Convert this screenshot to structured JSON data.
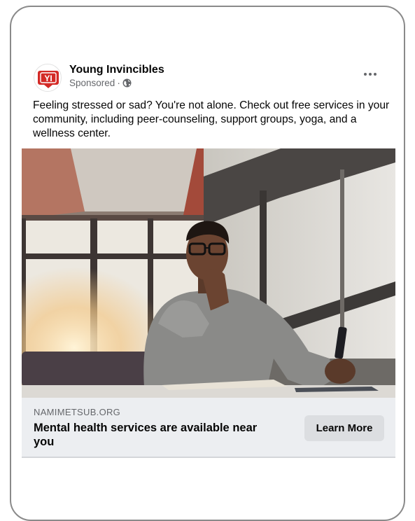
{
  "ad": {
    "page_name": "Young Invincibles",
    "sponsored_label": "Sponsored",
    "separator": "·",
    "logo_text": "YI",
    "body_text": "Feeling stressed or sad? You're not alone. Check out free services in your community, including peer-counseling, support groups, yoga, and a wellness center.",
    "image_description_icon": "photo-man-thinking",
    "link": {
      "domain": "NAMIMETSUB.ORG",
      "headline": "Mental health services are available near you",
      "cta_label": "Learn More"
    }
  },
  "icons": {
    "privacy": "globe-icon",
    "menu": "more-options-icon"
  },
  "colors": {
    "logo_red": "#d32a26",
    "link_bar_bg": "#eceef1",
    "cta_bg": "#dcdee1",
    "secondary_text": "#65676b"
  }
}
